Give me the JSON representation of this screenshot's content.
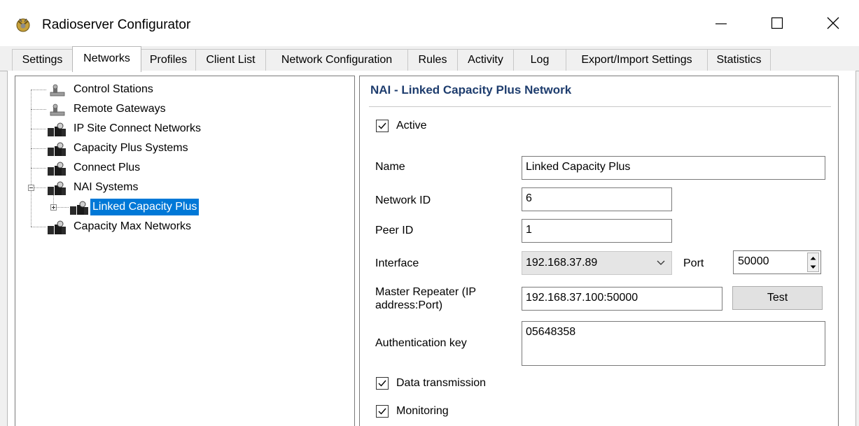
{
  "window": {
    "title": "Radioserver Configurator",
    "icon": "app-icon",
    "controls": [
      "minimize-icon",
      "maximize-icon",
      "close-icon"
    ]
  },
  "tabs": [
    {
      "label": "Settings",
      "active": false
    },
    {
      "label": "Networks",
      "active": true
    },
    {
      "label": "Profiles",
      "active": false
    },
    {
      "label": "Client List",
      "active": false
    },
    {
      "label": "Network Configuration",
      "active": false
    },
    {
      "label": "Rules",
      "active": false
    },
    {
      "label": "Activity",
      "active": false
    },
    {
      "label": "Log",
      "active": false
    },
    {
      "label": "Export/Import Settings",
      "active": false
    },
    {
      "label": "Statistics",
      "active": false
    }
  ],
  "tree": {
    "items": [
      {
        "label": "Control Stations",
        "icon": "control-station-icon"
      },
      {
        "label": "Remote Gateways",
        "icon": "remote-gateway-icon"
      },
      {
        "label": "IP Site Connect Networks",
        "icon": "network-icon"
      },
      {
        "label": "Capacity Plus Systems",
        "icon": "network-icon"
      },
      {
        "label": "Connect Plus",
        "icon": "network-icon"
      },
      {
        "label": "NAI Systems",
        "icon": "network-icon",
        "expanded": true
      },
      {
        "label": "Linked Capacity Plus",
        "icon": "network-icon",
        "selected": true,
        "collapsed": true
      },
      {
        "label": "Capacity Max Networks",
        "icon": "network-icon"
      }
    ]
  },
  "detail": {
    "header": "NAI - Linked Capacity Plus Network",
    "active": {
      "label": "Active",
      "checked": true
    },
    "name": {
      "label": "Name",
      "value": "Linked Capacity Plus"
    },
    "network_id": {
      "label": "Network ID",
      "value": "6"
    },
    "peer_id": {
      "label": "Peer ID",
      "value": "1"
    },
    "interface": {
      "label": "Interface",
      "value": "192.168.37.89"
    },
    "port": {
      "label": "Port",
      "value": "50000"
    },
    "master_repeater": {
      "label_line1": "Master Repeater (IP",
      "label_line2": "address:Port)",
      "value": "192.168.37.100:50000"
    },
    "test_button": "Test",
    "auth_key": {
      "label": "Authentication key",
      "value": "05648358"
    },
    "data_transmission": {
      "label": "Data transmission",
      "checked": true
    },
    "monitoring": {
      "label": "Monitoring",
      "checked": true
    }
  },
  "colors": {
    "selection": "#0078d7",
    "header_text": "#1e3d6e",
    "window_bg": "#f0f0f0"
  }
}
